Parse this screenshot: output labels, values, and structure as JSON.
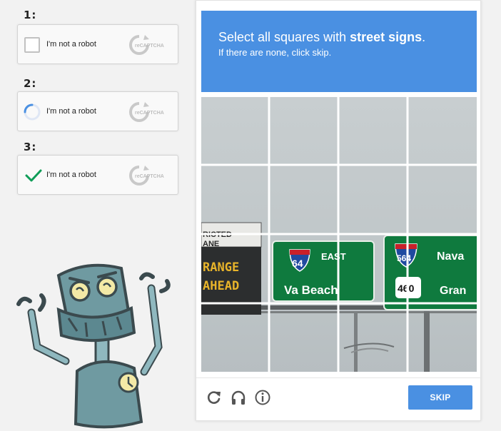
{
  "steps": [
    {
      "number": "1:",
      "label": "I'm not a robot",
      "state": "unchecked"
    },
    {
      "number": "2:",
      "label": "I'm not a robot",
      "state": "loading"
    },
    {
      "number": "3:",
      "label": "I'm not a robot",
      "state": "checked"
    }
  ],
  "brand": {
    "logo_text": "reCAPTCHA",
    "logo_small": "TM"
  },
  "challenge": {
    "instruction_prefix": "Select all squares with ",
    "instruction_target": "street signs",
    "instruction_suffix": ".",
    "sub_instruction": "If there are none, click skip.",
    "grid_rows": 4,
    "grid_cols": 4
  },
  "scene_signs": {
    "left_sign_top": "RICTED",
    "left_sign_mid": "ANE",
    "led_line1": "RANGE",
    "led_line2": "AHEAD",
    "sign_a_route": "64",
    "sign_a_dir": "EAST",
    "sign_a_dest": "Va Beach",
    "sign_b_route": "564",
    "sign_b_route2": "460",
    "sign_b_dest1": "Nava",
    "sign_b_dest2": "Gran"
  },
  "footer": {
    "reload_icon": "reload-icon",
    "audio_icon": "headphones-icon",
    "info_icon": "info-icon",
    "skip_label": "SKIP"
  },
  "colors": {
    "accent": "#4a90e2",
    "check_green": "#0f9d58",
    "sign_green": "#0f7a3e",
    "led_amber": "#e8b42a"
  }
}
